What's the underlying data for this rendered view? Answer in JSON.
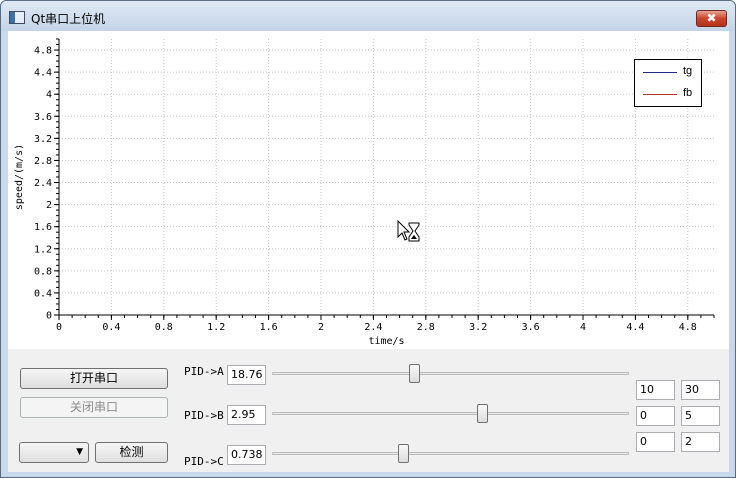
{
  "window": {
    "title": "Qt串口上位机",
    "close_glyph": "✖"
  },
  "plot": {
    "xlabel": "time/s",
    "ylabel": "speed/(m/s)",
    "x_ticks": [
      "0",
      "0.4",
      "0.8",
      "1.2",
      "1.6",
      "2",
      "2.4",
      "2.8",
      "3.2",
      "3.6",
      "4",
      "4.4",
      "4.8"
    ],
    "y_ticks": [
      "0",
      "0.4",
      "0.8",
      "1.2",
      "1.6",
      "2",
      "2.4",
      "2.8",
      "3.2",
      "3.6",
      "4",
      "4.4",
      "4.8"
    ],
    "legend": [
      {
        "label": "tg",
        "color": "#1f2f8f"
      },
      {
        "label": "fb",
        "color": "#b8322a"
      }
    ]
  },
  "chart_data": {
    "type": "line",
    "xlabel": "time/s",
    "ylabel": "speed/(m/s)",
    "xlim": [
      0,
      5
    ],
    "ylim": [
      0,
      5
    ],
    "grid": true,
    "legend_position": "top-right",
    "series": [
      {
        "name": "tg",
        "color": "#1f2f8f",
        "x": [],
        "y": []
      },
      {
        "name": "fb",
        "color": "#b8322a",
        "x": [],
        "y": []
      }
    ]
  },
  "controls": {
    "open_port_label": "打开串口",
    "close_port_label": "关闭串口",
    "detect_label": "检测",
    "port_select_value": ""
  },
  "pid": {
    "a": {
      "label": "PID->A",
      "value": "18.76",
      "slider_fraction": 0.4,
      "min": "10",
      "max": "30"
    },
    "b": {
      "label": "PID->B",
      "value": "2.95",
      "slider_fraction": 0.59,
      "min": "0",
      "max": "5"
    },
    "c": {
      "label": "PID->C",
      "value": "0.738",
      "slider_fraction": 0.369,
      "min": "0",
      "max": "2"
    }
  }
}
